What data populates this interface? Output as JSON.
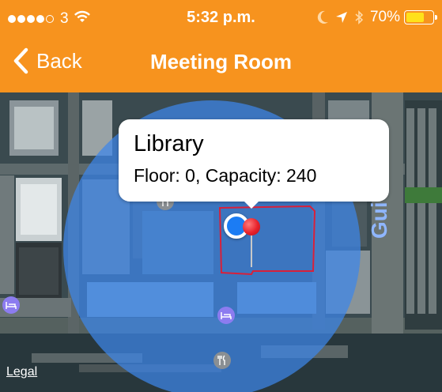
{
  "status_bar": {
    "carrier": "3",
    "time": "5:32 p.m.",
    "battery_percent": "70%",
    "battery_level": 0.7,
    "signal_bars_filled": 4,
    "signal_bars_total": 5
  },
  "nav": {
    "back_label": "Back",
    "title": "Meeting Room"
  },
  "map": {
    "callout": {
      "title": "Library",
      "subtitle": "Floor: 0, Capacity: 240"
    },
    "street_label": "Gui",
    "legal_label": "Legal"
  },
  "colors": {
    "header": "#f7931e",
    "accent_blue": "#1b7cf4",
    "radius_fill": "#3d86ea",
    "pin_red": "#e8212a",
    "building_outline": "#d8203a"
  },
  "icons": [
    "chevron-left-icon",
    "wifi-icon",
    "moon-icon",
    "location-arrow-icon",
    "bluetooth-icon",
    "battery-icon",
    "hotel-icon",
    "restaurant-icon"
  ]
}
